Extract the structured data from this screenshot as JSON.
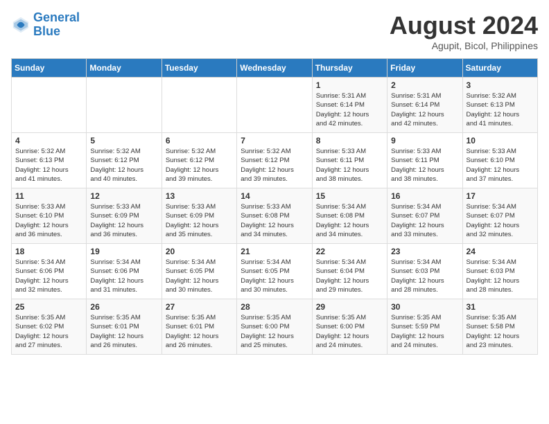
{
  "header": {
    "logo_line1": "General",
    "logo_line2": "Blue",
    "month_year": "August 2024",
    "location": "Agupit, Bicol, Philippines"
  },
  "weekdays": [
    "Sunday",
    "Monday",
    "Tuesday",
    "Wednesday",
    "Thursday",
    "Friday",
    "Saturday"
  ],
  "weeks": [
    [
      {
        "day": "",
        "info": ""
      },
      {
        "day": "",
        "info": ""
      },
      {
        "day": "",
        "info": ""
      },
      {
        "day": "",
        "info": ""
      },
      {
        "day": "1",
        "info": "Sunrise: 5:31 AM\nSunset: 6:14 PM\nDaylight: 12 hours\nand 42 minutes."
      },
      {
        "day": "2",
        "info": "Sunrise: 5:31 AM\nSunset: 6:14 PM\nDaylight: 12 hours\nand 42 minutes."
      },
      {
        "day": "3",
        "info": "Sunrise: 5:32 AM\nSunset: 6:13 PM\nDaylight: 12 hours\nand 41 minutes."
      }
    ],
    [
      {
        "day": "4",
        "info": "Sunrise: 5:32 AM\nSunset: 6:13 PM\nDaylight: 12 hours\nand 41 minutes."
      },
      {
        "day": "5",
        "info": "Sunrise: 5:32 AM\nSunset: 6:12 PM\nDaylight: 12 hours\nand 40 minutes."
      },
      {
        "day": "6",
        "info": "Sunrise: 5:32 AM\nSunset: 6:12 PM\nDaylight: 12 hours\nand 39 minutes."
      },
      {
        "day": "7",
        "info": "Sunrise: 5:32 AM\nSunset: 6:12 PM\nDaylight: 12 hours\nand 39 minutes."
      },
      {
        "day": "8",
        "info": "Sunrise: 5:33 AM\nSunset: 6:11 PM\nDaylight: 12 hours\nand 38 minutes."
      },
      {
        "day": "9",
        "info": "Sunrise: 5:33 AM\nSunset: 6:11 PM\nDaylight: 12 hours\nand 38 minutes."
      },
      {
        "day": "10",
        "info": "Sunrise: 5:33 AM\nSunset: 6:10 PM\nDaylight: 12 hours\nand 37 minutes."
      }
    ],
    [
      {
        "day": "11",
        "info": "Sunrise: 5:33 AM\nSunset: 6:10 PM\nDaylight: 12 hours\nand 36 minutes."
      },
      {
        "day": "12",
        "info": "Sunrise: 5:33 AM\nSunset: 6:09 PM\nDaylight: 12 hours\nand 36 minutes."
      },
      {
        "day": "13",
        "info": "Sunrise: 5:33 AM\nSunset: 6:09 PM\nDaylight: 12 hours\nand 35 minutes."
      },
      {
        "day": "14",
        "info": "Sunrise: 5:33 AM\nSunset: 6:08 PM\nDaylight: 12 hours\nand 34 minutes."
      },
      {
        "day": "15",
        "info": "Sunrise: 5:34 AM\nSunset: 6:08 PM\nDaylight: 12 hours\nand 34 minutes."
      },
      {
        "day": "16",
        "info": "Sunrise: 5:34 AM\nSunset: 6:07 PM\nDaylight: 12 hours\nand 33 minutes."
      },
      {
        "day": "17",
        "info": "Sunrise: 5:34 AM\nSunset: 6:07 PM\nDaylight: 12 hours\nand 32 minutes."
      }
    ],
    [
      {
        "day": "18",
        "info": "Sunrise: 5:34 AM\nSunset: 6:06 PM\nDaylight: 12 hours\nand 32 minutes."
      },
      {
        "day": "19",
        "info": "Sunrise: 5:34 AM\nSunset: 6:06 PM\nDaylight: 12 hours\nand 31 minutes."
      },
      {
        "day": "20",
        "info": "Sunrise: 5:34 AM\nSunset: 6:05 PM\nDaylight: 12 hours\nand 30 minutes."
      },
      {
        "day": "21",
        "info": "Sunrise: 5:34 AM\nSunset: 6:05 PM\nDaylight: 12 hours\nand 30 minutes."
      },
      {
        "day": "22",
        "info": "Sunrise: 5:34 AM\nSunset: 6:04 PM\nDaylight: 12 hours\nand 29 minutes."
      },
      {
        "day": "23",
        "info": "Sunrise: 5:34 AM\nSunset: 6:03 PM\nDaylight: 12 hours\nand 28 minutes."
      },
      {
        "day": "24",
        "info": "Sunrise: 5:34 AM\nSunset: 6:03 PM\nDaylight: 12 hours\nand 28 minutes."
      }
    ],
    [
      {
        "day": "25",
        "info": "Sunrise: 5:35 AM\nSunset: 6:02 PM\nDaylight: 12 hours\nand 27 minutes."
      },
      {
        "day": "26",
        "info": "Sunrise: 5:35 AM\nSunset: 6:01 PM\nDaylight: 12 hours\nand 26 minutes."
      },
      {
        "day": "27",
        "info": "Sunrise: 5:35 AM\nSunset: 6:01 PM\nDaylight: 12 hours\nand 26 minutes."
      },
      {
        "day": "28",
        "info": "Sunrise: 5:35 AM\nSunset: 6:00 PM\nDaylight: 12 hours\nand 25 minutes."
      },
      {
        "day": "29",
        "info": "Sunrise: 5:35 AM\nSunset: 6:00 PM\nDaylight: 12 hours\nand 24 minutes."
      },
      {
        "day": "30",
        "info": "Sunrise: 5:35 AM\nSunset: 5:59 PM\nDaylight: 12 hours\nand 24 minutes."
      },
      {
        "day": "31",
        "info": "Sunrise: 5:35 AM\nSunset: 5:58 PM\nDaylight: 12 hours\nand 23 minutes."
      }
    ]
  ]
}
